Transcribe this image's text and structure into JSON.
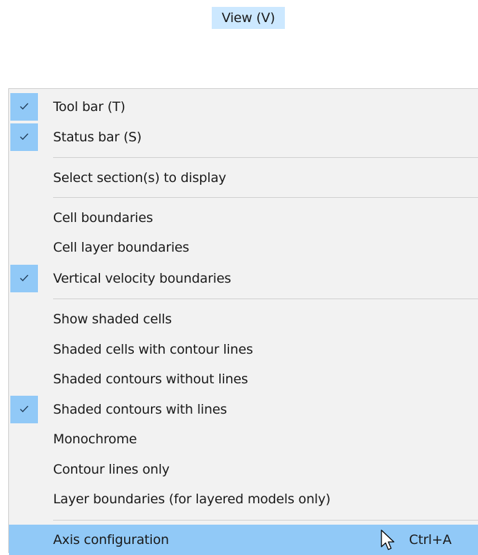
{
  "menubar": {
    "view_label": "View (V)"
  },
  "menu": {
    "items": [
      {
        "label": "Tool bar (T)",
        "checked": true
      },
      {
        "label": "Status bar (S)",
        "checked": true
      },
      {
        "label": "Select section(s) to display",
        "checked": false
      },
      {
        "label": "Cell boundaries",
        "checked": false
      },
      {
        "label": "Cell layer boundaries",
        "checked": false
      },
      {
        "label": "Vertical velocity boundaries",
        "checked": true
      },
      {
        "label": "Show shaded cells",
        "checked": false
      },
      {
        "label": "Shaded cells with contour lines",
        "checked": false
      },
      {
        "label": "Shaded contours without lines",
        "checked": false
      },
      {
        "label": "Shaded contours with lines",
        "checked": true
      },
      {
        "label": "Monochrome",
        "checked": false
      },
      {
        "label": "Contour lines only",
        "checked": false
      },
      {
        "label": "Layer boundaries (for layered models only)",
        "checked": false
      },
      {
        "label": "Axis configuration",
        "checked": false,
        "highlighted": true,
        "shortcut": "Ctrl+A"
      }
    ]
  },
  "icons": {
    "check": "checkmark-icon",
    "cursor": "mouse-pointer-icon"
  },
  "colors": {
    "menubar_highlight": "#cce8ff",
    "item_highlight": "#91c9f7",
    "check_background": "#91c9f7",
    "menu_background": "#f2f2f2"
  }
}
